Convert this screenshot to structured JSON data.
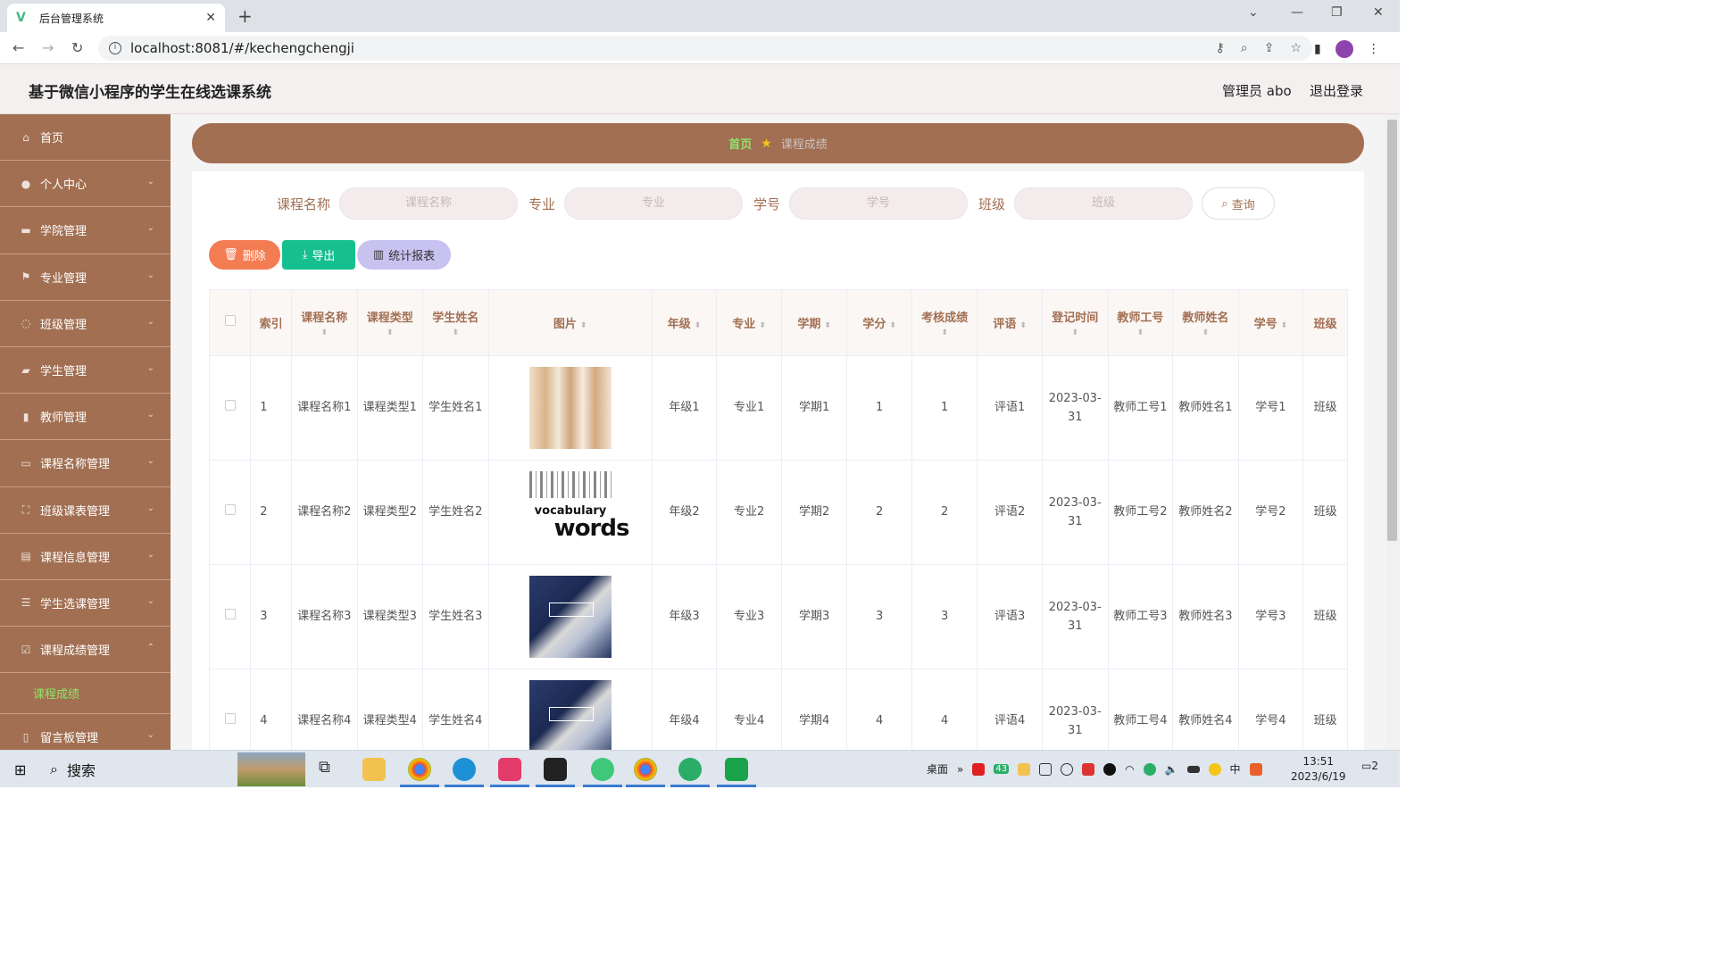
{
  "browser": {
    "tab_title": "后台管理系统",
    "url": "localhost:8081/#/kechengchengji"
  },
  "app": {
    "title": "基于微信小程序的学生在线选课系统",
    "user": "管理员 abo",
    "logout": "退出登录"
  },
  "sidebar": {
    "items": [
      {
        "label": "首页",
        "icon": "home-icon"
      },
      {
        "label": "个人中心",
        "icon": "user-icon"
      },
      {
        "label": "学院管理",
        "icon": "monitor-icon"
      },
      {
        "label": "专业管理",
        "icon": "flag-icon"
      },
      {
        "label": "班级管理",
        "icon": "circle-icon"
      },
      {
        "label": "学生管理",
        "icon": "student-icon"
      },
      {
        "label": "教师管理",
        "icon": "bar-icon"
      },
      {
        "label": "课程名称管理",
        "icon": "card-icon"
      },
      {
        "label": "班级课表管理",
        "icon": "frame-icon"
      },
      {
        "label": "课程信息管理",
        "icon": "doc-icon"
      },
      {
        "label": "学生选课管理",
        "icon": "sliders-icon"
      },
      {
        "label": "课程成绩管理",
        "icon": "check-icon"
      },
      {
        "label": "留言板管理",
        "icon": "phone-icon"
      }
    ],
    "active_sub": "课程成绩"
  },
  "breadcrumb": {
    "home": "首页",
    "current": "课程成绩"
  },
  "search": {
    "fields": [
      {
        "label": "课程名称",
        "placeholder": "课程名称"
      },
      {
        "label": "专业",
        "placeholder": "专业"
      },
      {
        "label": "学号",
        "placeholder": "学号"
      },
      {
        "label": "班级",
        "placeholder": "班级"
      }
    ],
    "query_label": "查询"
  },
  "actions": {
    "delete": "删除",
    "export": "导出",
    "report": "统计报表"
  },
  "table": {
    "headers": [
      "索引",
      "课程名称",
      "课程类型",
      "学生姓名",
      "图片",
      "年级",
      "专业",
      "学期",
      "学分",
      "考核成绩",
      "评语",
      "登记时间",
      "教师工号",
      "教师姓名",
      "学号",
      "班级"
    ],
    "rows": [
      {
        "index": "1",
        "course": "课程名称1",
        "type": "课程类型1",
        "student": "学生姓名1",
        "grade": "年级1",
        "major": "专业1",
        "term": "学期1",
        "credit": "1",
        "score": "1",
        "comment": "评语1",
        "date": "2023-03-31",
        "tid": "教师工号1",
        "tname": "教师姓名1",
        "sid": "学号1",
        "cls": "班级"
      },
      {
        "index": "2",
        "course": "课程名称2",
        "type": "课程类型2",
        "student": "学生姓名2",
        "grade": "年级2",
        "major": "专业2",
        "term": "学期2",
        "credit": "2",
        "score": "2",
        "comment": "评语2",
        "date": "2023-03-31",
        "tid": "教师工号2",
        "tname": "教师姓名2",
        "sid": "学号2",
        "cls": "班级"
      },
      {
        "index": "3",
        "course": "课程名称3",
        "type": "课程类型3",
        "student": "学生姓名3",
        "grade": "年级3",
        "major": "专业3",
        "term": "学期3",
        "credit": "3",
        "score": "3",
        "comment": "评语3",
        "date": "2023-03-31",
        "tid": "教师工号3",
        "tname": "教师姓名3",
        "sid": "学号3",
        "cls": "班级"
      },
      {
        "index": "4",
        "course": "课程名称4",
        "type": "课程类型4",
        "student": "学生姓名4",
        "grade": "年级4",
        "major": "专业4",
        "term": "学期4",
        "credit": "4",
        "score": "4",
        "comment": "评语4",
        "date": "2023-03-31",
        "tid": "教师工号4",
        "tname": "教师姓名4",
        "sid": "学号4",
        "cls": "班级"
      }
    ],
    "img2_words": {
      "w1": "vocabulary",
      "w2": "words"
    }
  },
  "taskbar": {
    "search": "搜索",
    "desktop": "桌面",
    "time": "13:51",
    "date": "2023/6/19",
    "notif_count": "2",
    "tray_badge": "43"
  }
}
